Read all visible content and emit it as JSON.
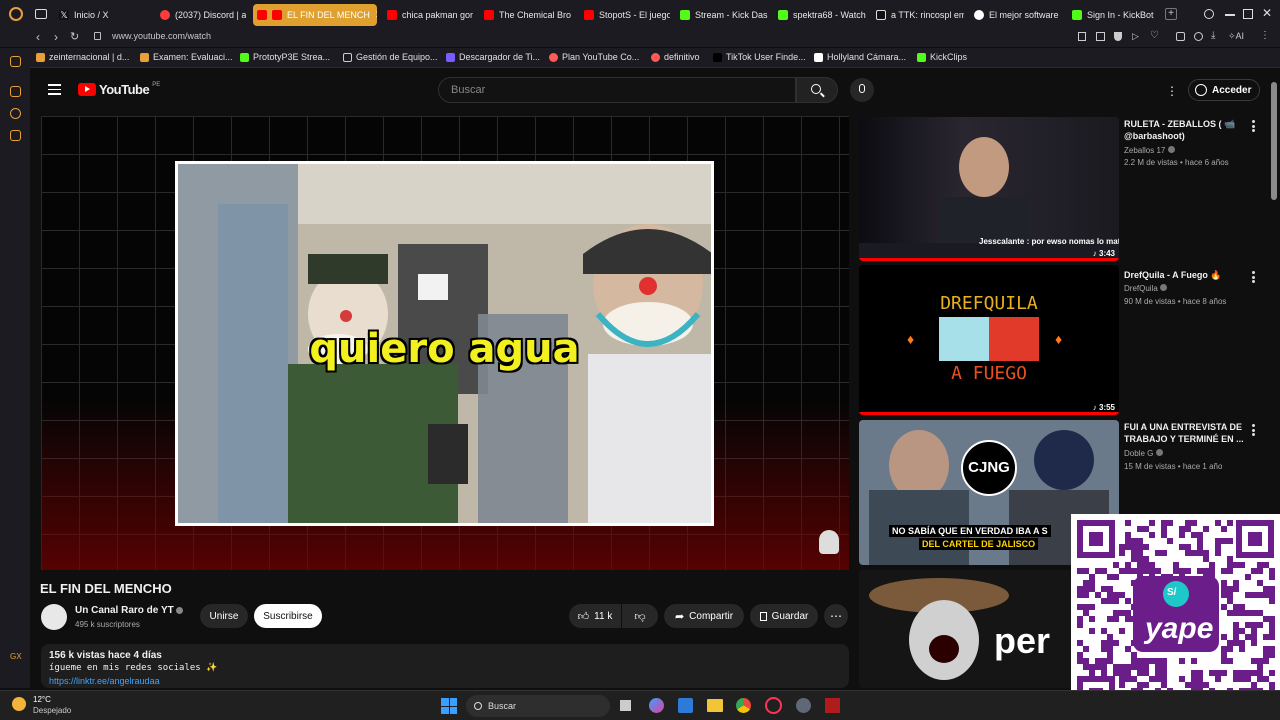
{
  "tabs": [
    {
      "label": "Inicio / X",
      "color": "#ffffff"
    },
    {
      "label": "(2037) Discord | a",
      "color": "#ff3b3b"
    },
    {
      "label": "EL FIN DEL MENCH",
      "color": "#ff0000",
      "active": true
    },
    {
      "label": "chica pakman gor",
      "color": "#ff0000"
    },
    {
      "label": "The Chemical Bro",
      "color": "#ff0000"
    },
    {
      "label": "StopotS - El juego",
      "color": "#ff0000"
    },
    {
      "label": "Stream - Kick Das",
      "color": "#53fc18"
    },
    {
      "label": "spektra68 - Watch",
      "color": "#53fc18"
    },
    {
      "label": "a TTK: rincospl em",
      "color": "#ffffff"
    },
    {
      "label": "El mejor software",
      "color": "#ffffff"
    },
    {
      "label": "Sign In - KickBot",
      "color": "#53fc18"
    }
  ],
  "address": {
    "url": "www.youtube.com/watch",
    "ai_label": "AI"
  },
  "bookmarks": [
    {
      "label": "zeinternacional | d...",
      "color": "#e8a03a"
    },
    {
      "label": "Examen: Evaluaci...",
      "color": "#e8a03a"
    },
    {
      "label": "PrototyP3E Strea...",
      "color": "#53fc18"
    },
    {
      "label": "Gestión de Equipo...",
      "color": "#cccccc"
    },
    {
      "label": "Descargador de Ti...",
      "color": "#7a5cff"
    },
    {
      "label": "Plan YouTube Co...",
      "color": "#ff5a5a"
    },
    {
      "label": "definitivo",
      "color": "#ff5a5a"
    },
    {
      "label": "TikTok User Finde...",
      "color": "#000000"
    },
    {
      "label": "Hollyland Cámara...",
      "color": "#ffffff"
    },
    {
      "label": "KickClips",
      "color": "#53fc18"
    }
  ],
  "youtube": {
    "logo_text": "YouTube",
    "region": "PE",
    "search_placeholder": "Buscar",
    "login_label": "Acceder"
  },
  "video": {
    "caption": "quiero agua",
    "title": "EL FIN DEL MENCHO",
    "channel": "Un Canal Raro de YT",
    "subscribers": "495 k suscriptores",
    "join_label": "Unirse",
    "subscribe_label": "Suscribirse",
    "likes": "11 k",
    "share_label": "Compartir",
    "save_label": "Guardar",
    "views_date": "156 k vistas  hace 4 días",
    "description_line": "ígueme en mis redes sociales ✨",
    "link": "https://linktr.ee/angelraudaa"
  },
  "related": [
    {
      "title": "RULETA - ZEBALLOS ( 📹 @barbashoot)",
      "channel": "Zeballos 17",
      "meta": "2.2 M de vistas • hace 6 años",
      "duration": "♪ 3:43",
      "overlay": "Jesscalante : por ewso nomas lo mataron a su hermano de la jefa"
    },
    {
      "title": "DrefQuila - A Fuego 🔥",
      "channel": "DrefQuila",
      "meta": "90 M de vistas • hace 8 años",
      "duration": "♪ 3:55",
      "thumb_top": "DREFQUILA",
      "thumb_bottom": "A FUEGO"
    },
    {
      "title": "FUI A UNA ENTREVISTA DE TRABAJO Y TERMINÉ EN ...",
      "channel": "Doble G",
      "meta": "15 M de vistas • hace 1 año",
      "thumb_badge": "CJNG",
      "thumb_line1": "NO SABÍA QUE EN VERDAD IBA A S",
      "thumb_line2": "DEL CARTEL DE JALISCO"
    },
    {
      "thumb_text": "per"
    }
  ],
  "qr": {
    "brand": "yape",
    "symbol": "S/"
  },
  "taskbar": {
    "temperature": "12°C",
    "weather": "Despejado",
    "search_label": "Buscar"
  },
  "sidebar_label": "GX"
}
